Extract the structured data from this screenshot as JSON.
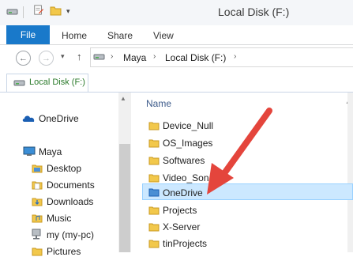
{
  "window": {
    "title": "Local Disk (F:)"
  },
  "ribbon": {
    "file": "File",
    "tabs": [
      "Home",
      "Share",
      "View"
    ]
  },
  "address": {
    "crumbs": [
      "Maya",
      "Local Disk (F:)"
    ],
    "back": "←",
    "forward": "→",
    "up": "↑"
  },
  "location_tab": {
    "label": "Local Disk (F:)"
  },
  "nav": {
    "items": [
      {
        "label": "OneDrive"
      },
      {
        "label": "Maya"
      },
      {
        "label": "Desktop"
      },
      {
        "label": "Documents"
      },
      {
        "label": "Downloads"
      },
      {
        "label": "Music"
      },
      {
        "label": "my (my-pc)"
      },
      {
        "label": "Pictures"
      }
    ]
  },
  "content": {
    "header_name": "Name",
    "rows": [
      {
        "label": "Device_Null"
      },
      {
        "label": "OS_Images"
      },
      {
        "label": "Softwares"
      },
      {
        "label": "Video_Son"
      },
      {
        "label": "OneDrive"
      },
      {
        "label": "Projects"
      },
      {
        "label": "X-Server"
      },
      {
        "label": "tinProjects"
      }
    ],
    "selected_row": "OneDrive"
  },
  "colors": {
    "accent": "#1979ca",
    "selection": "#cce8ff",
    "arrow": "#e4453c",
    "folder": "#f2c84b"
  }
}
